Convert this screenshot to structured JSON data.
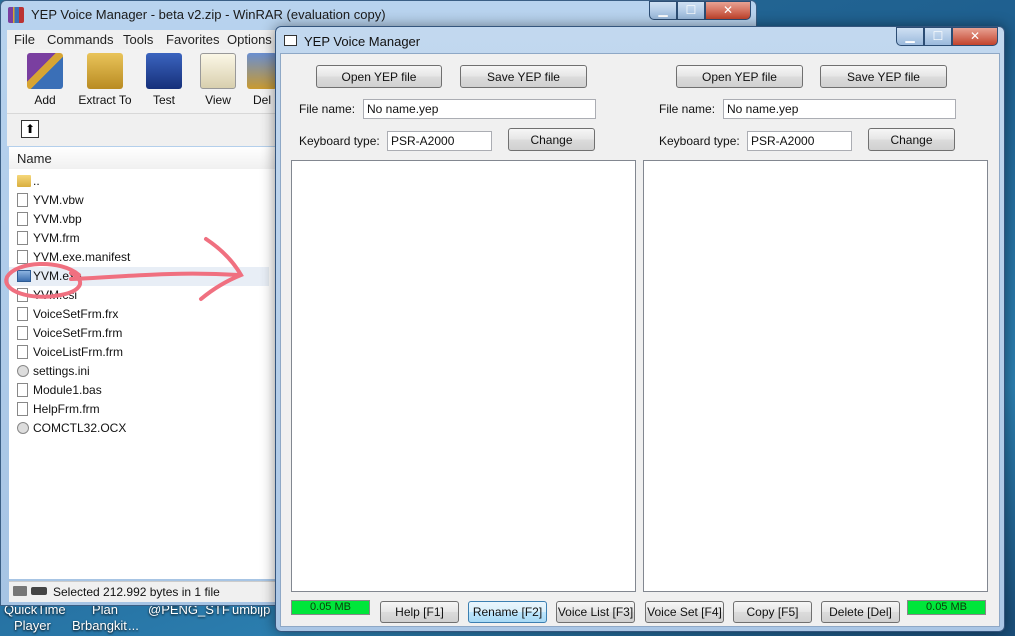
{
  "desktop": {
    "labels": [
      "QuickTime",
      "Plan",
      "@PENG_STF",
      "umbijp",
      "Player",
      "Brbangkit",
      "..."
    ]
  },
  "winrar": {
    "title": "YEP Voice Manager - beta v2.zip - WinRAR (evaluation copy)",
    "caption": {
      "minimize": "▁",
      "maximize": "☐",
      "close": "✕"
    },
    "menu": [
      "File",
      "Commands",
      "Tools",
      "Favorites",
      "Options"
    ],
    "toolbar": [
      {
        "label": "Add",
        "icon": "add-icon",
        "color": "#7a3fa0"
      },
      {
        "label": "Extract To",
        "icon": "extract-icon",
        "color": "#d7a533"
      },
      {
        "label": "Test",
        "icon": "test-icon",
        "color": "#2a4fa0"
      },
      {
        "label": "View",
        "icon": "view-icon",
        "color": "#e8e3d0"
      },
      {
        "label": "Del",
        "icon": "delete-icon",
        "color": "#c99a30"
      }
    ],
    "up_icon": "⬆",
    "column_name": "Name",
    "files": [
      {
        "name": "..",
        "type": "folder"
      },
      {
        "name": "YVM.vbw",
        "type": "file"
      },
      {
        "name": "YVM.vbp",
        "type": "file"
      },
      {
        "name": "YVM.frm",
        "type": "file"
      },
      {
        "name": "YVM.exe.manifest",
        "type": "file"
      },
      {
        "name": "YVM.exe",
        "type": "exe"
      },
      {
        "name": "YVM.csi",
        "type": "file"
      },
      {
        "name": "VoiceSetFrm.frx",
        "type": "file"
      },
      {
        "name": "VoiceSetFrm.frm",
        "type": "file"
      },
      {
        "name": "VoiceListFrm.frm",
        "type": "file"
      },
      {
        "name": "settings.ini",
        "type": "gear"
      },
      {
        "name": "Module1.bas",
        "type": "file"
      },
      {
        "name": "HelpFrm.frm",
        "type": "file"
      },
      {
        "name": "COMCTL32.OCX",
        "type": "gear"
      }
    ],
    "status": "Selected 212.992 bytes in 1 file"
  },
  "yep": {
    "title": "YEP Voice Manager",
    "caption": {
      "minimize": "▁",
      "maximize": "☐",
      "close": "✕"
    },
    "left": {
      "open": "Open YEP file",
      "save": "Save YEP file",
      "file_label": "File name:",
      "file_value": "No name.yep",
      "kb_label": "Keyboard type:",
      "kb_value": "PSR-A2000",
      "change": "Change",
      "meter": "0.05 MB"
    },
    "right": {
      "open": "Open YEP file",
      "save": "Save YEP file",
      "file_label": "File name:",
      "file_value": "No name.yep",
      "kb_label": "Keyboard type:",
      "kb_value": "PSR-A2000",
      "change": "Change",
      "meter": "0.05 MB"
    },
    "bottom_buttons": {
      "help": "Help [F1]",
      "rename": "Rename [F2]",
      "voice_list": "Voice List [F3]",
      "voice_set": "Voice Set [F4]",
      "copy": "Copy [F5]",
      "delete": "Delete [Del]"
    },
    "colors": {
      "meter": "#00e63a",
      "annotation": "#f07080"
    }
  }
}
